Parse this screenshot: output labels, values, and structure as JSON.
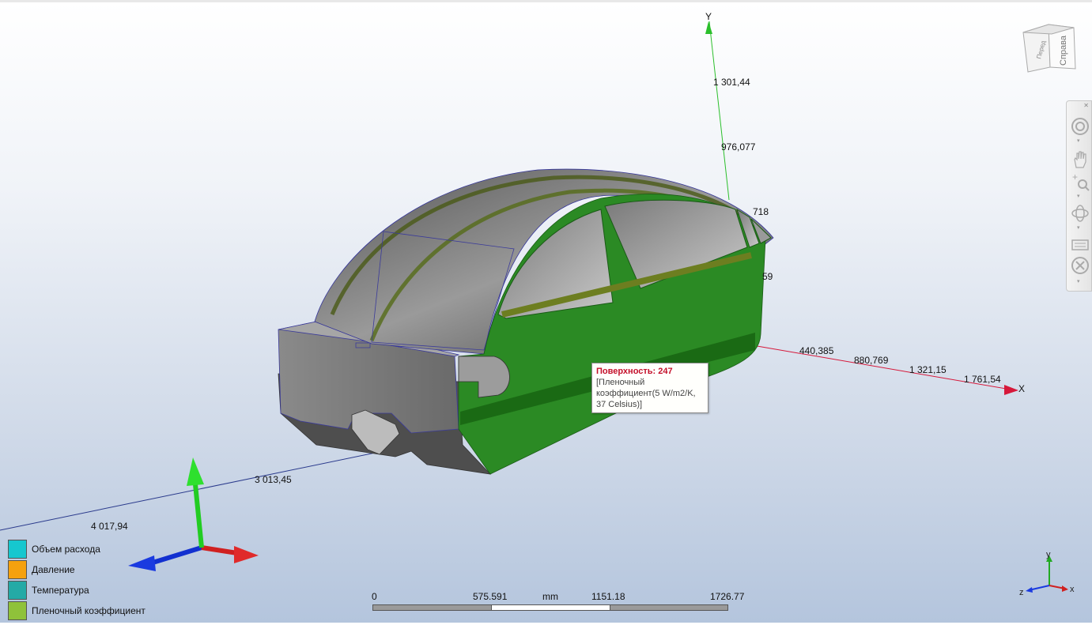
{
  "axes": {
    "y_label": "Y",
    "x_label": "X",
    "y_ticks": [
      "1 301,44",
      "976,077",
      "718",
      "59"
    ],
    "x_ticks": [
      "440,385",
      "880,769",
      "1 321,15",
      "1 761,54"
    ],
    "z_ticks": [
      "3 013,45",
      "4 017,94"
    ]
  },
  "tooltip": {
    "title": "Поверхность: 247",
    "line1": "[Пленочный",
    "line2": "коэффициент(5 W/m2/K,",
    "line3": "37 Celsius)]"
  },
  "legend": {
    "items": [
      {
        "label": "Объем расхода",
        "color": "#16c7cf"
      },
      {
        "label": "Давление",
        "color": "#f5a10e"
      },
      {
        "label": "Температура",
        "color": "#24aaa6"
      },
      {
        "label": "Пленочный коэффициент",
        "color": "#8fc23a"
      }
    ]
  },
  "scale_bar": {
    "labels": [
      "0",
      "575.591",
      "mm",
      "1151.18",
      "1726.77"
    ]
  },
  "view_cube": {
    "face_front": "Справа",
    "face_side": "Перед"
  },
  "nav_bar": {
    "buttons": [
      "steering-wheel-icon",
      "pan-icon",
      "zoom-icon",
      "orbit-icon",
      "look-icon",
      "settings-icon"
    ]
  },
  "small_triad": {
    "x": "x",
    "y": "y",
    "z": "z"
  },
  "colors": {
    "body_green": "#2b8a24",
    "shell_gray": "#777777",
    "x_axis": "#d6183a",
    "y_axis": "#2bbf2b",
    "z_axis": "#2a3a8c"
  }
}
